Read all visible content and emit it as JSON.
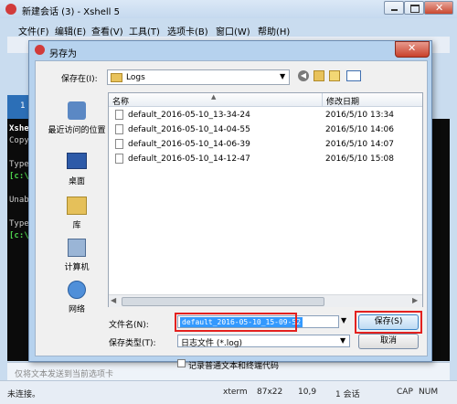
{
  "window": {
    "title": "新建会话 (3) - Xshell 5"
  },
  "menubar": {
    "items": [
      "文件(F)",
      "编辑(E)",
      "查看(V)",
      "工具(T)",
      "选项卡(B)",
      "窗口(W)",
      "帮助(H)"
    ]
  },
  "terminal": {
    "tab_label": "1",
    "lines": [
      "Xshe",
      "Copy",
      "",
      "Type",
      "[c:\\",
      "",
      "Unab",
      "",
      "Type",
      "[c:\\"
    ]
  },
  "sendbar": {
    "placeholder": "仅将文本发送到当前选项卡"
  },
  "status": {
    "left": "未连接。",
    "term": "xterm",
    "size": "87x22",
    "pos": "10,9",
    "sessions": "1 会话",
    "caps": "CAP",
    "num": "NUM"
  },
  "dialog": {
    "title": "另存为",
    "save_in_label": "保存在(I):",
    "save_in_value": "Logs",
    "places": [
      "最近访问的位置",
      "桌面",
      "库",
      "计算机",
      "网络"
    ],
    "columns": [
      "名称",
      "修改日期"
    ],
    "files": [
      {
        "name": "default_2016-05-10_13-34-24",
        "date": "2016/5/10 13:34"
      },
      {
        "name": "default_2016-05-10_14-04-55",
        "date": "2016/5/10 14:06"
      },
      {
        "name": "default_2016-05-10_14-06-39",
        "date": "2016/5/10 14:07"
      },
      {
        "name": "default_2016-05-10_14-12-47",
        "date": "2016/5/10 15:08"
      }
    ],
    "filename_label": "文件名(N):",
    "filename_value": "default_2016-05-10_15-09-52",
    "filetype_label": "保存类型(T):",
    "filetype_value": "日志文件 (*.log)",
    "save_button": "保存(S)",
    "cancel_button": "取消",
    "checkbox_label": "记录普通文本和终端代码"
  },
  "colors": {
    "highlight": "#e3211f",
    "selection": "#3399ff"
  }
}
